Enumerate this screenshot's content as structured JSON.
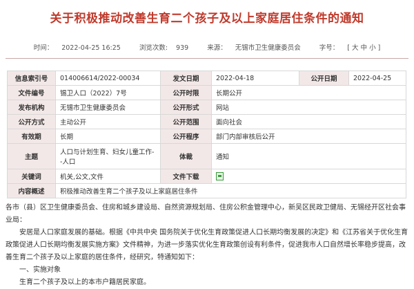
{
  "title": "关于积极推动改善生育二个孩子及以上家庭居住条件的通知",
  "meta": {
    "time_label": "时间：",
    "time_value": "2022-04-25 16:25",
    "views_label": "浏览次数:",
    "views_value": "939",
    "source_label": "来源：",
    "source_value": "无锡市卫生健康委员会",
    "font_label": "字号：",
    "font_size_option": "[ 大 中 小 ]"
  },
  "info": {
    "index_label": "信息索引号",
    "index_value": "014006614/2022-00034",
    "issue_date_label": "发文日期",
    "issue_date_value": "2022-04-18",
    "publish_date_label": "公开日期",
    "publish_date_value": "2022-04-25",
    "doc_no_label": "文件编号",
    "doc_no_value": "锡卫人口（2022）7号",
    "disclosure_time_label": "公开时限",
    "disclosure_time_value": "长期公开",
    "issuer_label": "发布机构",
    "issuer_value": "无锡市卫生健康委员会",
    "disclosure_form_label": "公开形式",
    "disclosure_form_value": "网站",
    "disclosure_method_label": "公开方式",
    "disclosure_method_value": "主动公开",
    "disclosure_scope_label": "公开范围",
    "disclosure_scope_value": "面向社会",
    "validity_label": "有效期",
    "validity_value": "长期",
    "review_label": "公开程序",
    "review_value": "部门内部审核后公开",
    "topic_label": "主题",
    "topic_value": "人口与计划生育、妇女儿童工作--人口",
    "genre_label": "体裁",
    "genre_value": "通知",
    "keywords_label": "关键词",
    "keywords_value": "机关,公文,文件",
    "download_label": "文件下载",
    "summary_label": "内容概述",
    "summary_value": "积极推动改善生育二个孩子及以上家庭居住条件"
  },
  "body": {
    "recipients": "各市（县）区卫生健康委员会、住房和城乡建设局、自然资源规划局、住房公积金管理中心，新吴区民政卫健局、无锡经开区社会事业局：",
    "paragraph1": "安居是人口家庭发展的基础。根据《中共中央  国务院关于优化生育政策促进人口长期均衡发展的决定》和《江苏省关于优化生育政策促进人口长期均衡发展实施方案》文件精神，为进一步落实优化生育政策创设有利条件，促进我市人口自然增长率稳步提高，改善生育二个孩子及以上家庭的居住条件，经研究，特通知如下：",
    "section1_heading": "一、实施对象",
    "section1_line1": "生育二个孩子及以上的本市户籍居民家庭。"
  }
}
